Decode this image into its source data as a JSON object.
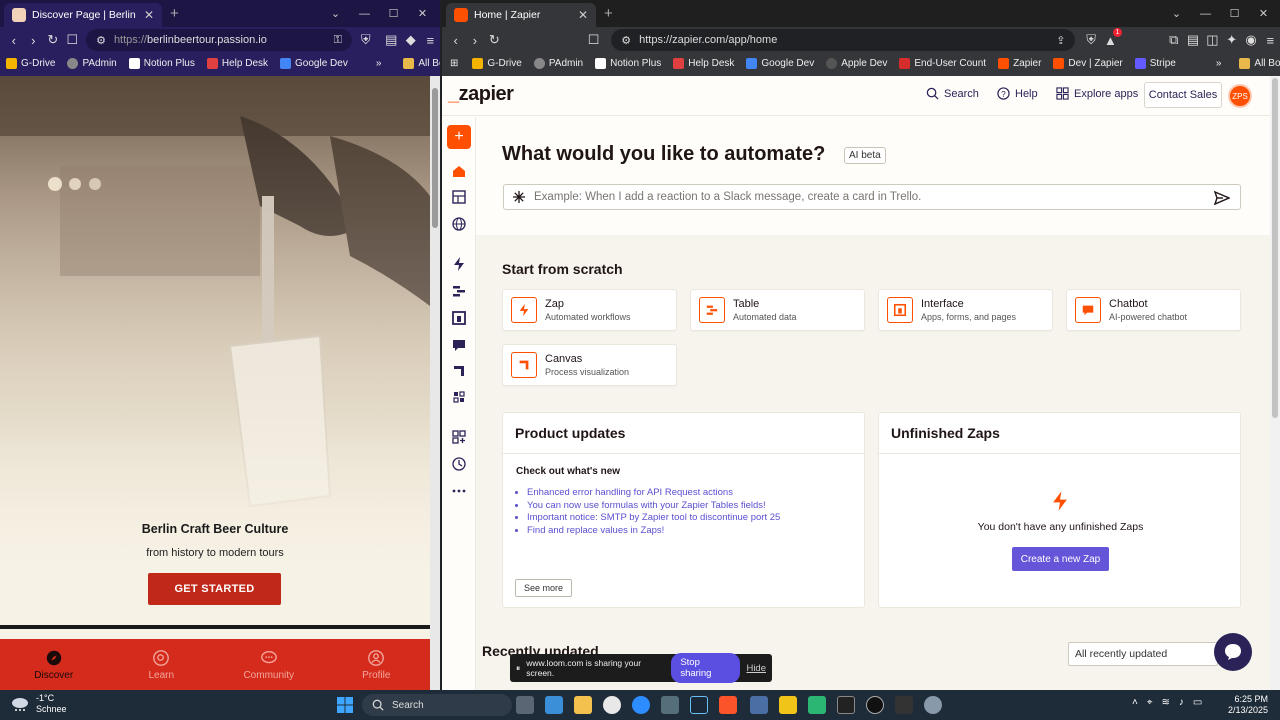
{
  "left_browser": {
    "tab_title": "Discover Page | Berlin Beer Tour",
    "url_proto": "https://",
    "url_host": "berlinbeertour.passion.io",
    "bookmarks": [
      "G-Drive",
      "PAdmin",
      "Notion Plus",
      "Help Desk",
      "Google Dev"
    ],
    "all_bookmarks": "All Bookmarks",
    "more": "»"
  },
  "beer_page": {
    "hero_title": "Berlin Craft Beer Culture",
    "hero_subtitle": "from history to modern tours",
    "cta_label": "GET STARTED",
    "nav": [
      {
        "label": "Discover",
        "icon": "compass-icon"
      },
      {
        "label": "Learn",
        "icon": "search-icon"
      },
      {
        "label": "Community",
        "icon": "chat-icon"
      },
      {
        "label": "Profile",
        "icon": "user-icon"
      }
    ],
    "accent": "#d42b1c"
  },
  "right_browser": {
    "tab_title": "Home | Zapier",
    "url": "https://zapier.com/app/home",
    "bookmarks": [
      "G-Drive",
      "PAdmin",
      "Notion Plus",
      "Help Desk",
      "Google Dev",
      "Apple Dev",
      "End-User Count",
      "Zapier",
      "Dev | Zapier",
      "Stripe"
    ],
    "all_bookmarks": "All Bookmarks",
    "more": "»",
    "notification_count": "1"
  },
  "zapier": {
    "logo_prefix": "_",
    "logo": "zapier",
    "header": {
      "search": "Search",
      "help": "Help",
      "explore": "Explore apps",
      "contact": "Contact Sales",
      "avatar": "ZPS"
    },
    "ask_title": "What would you like to automate?",
    "ai_badge": "AI beta",
    "prompt_placeholder": "Example: When I add a reaction to a Slack message, create a card in Trello.",
    "scratch_title": "Start from scratch",
    "cards": [
      {
        "name": "Zap",
        "desc": "Automated workflows"
      },
      {
        "name": "Table",
        "desc": "Automated data"
      },
      {
        "name": "Interface",
        "desc": "Apps, forms, and pages"
      },
      {
        "name": "Chatbot",
        "desc": "AI-powered chatbot"
      },
      {
        "name": "Canvas",
        "desc": "Process visualization"
      }
    ],
    "updates": {
      "title": "Product updates",
      "subtitle": "Check out what's new",
      "items": [
        "Enhanced error handling for API Request actions",
        "You can now use formulas with your Zapier Tables fields!",
        "Important notice: SMTP by Zapier tool to discontinue port 25",
        "Find and replace values in Zaps!"
      ],
      "see_more": "See more"
    },
    "unfinished": {
      "title": "Unfinished Zaps",
      "empty": "You don't have any unfinished Zaps",
      "button": "Create a new Zap"
    },
    "recent": {
      "title": "Recently updated",
      "filter": "All recently updated"
    },
    "accent": "#ff4f00",
    "button_color": "#6555d8"
  },
  "loom": {
    "message": "www.loom.com is sharing your screen.",
    "stop": "Stop sharing",
    "hide": "Hide"
  },
  "taskbar": {
    "temp": "-1°C",
    "condition": "Schnee",
    "search": "Search",
    "time": "6:25 PM",
    "date": "2/13/2025"
  }
}
